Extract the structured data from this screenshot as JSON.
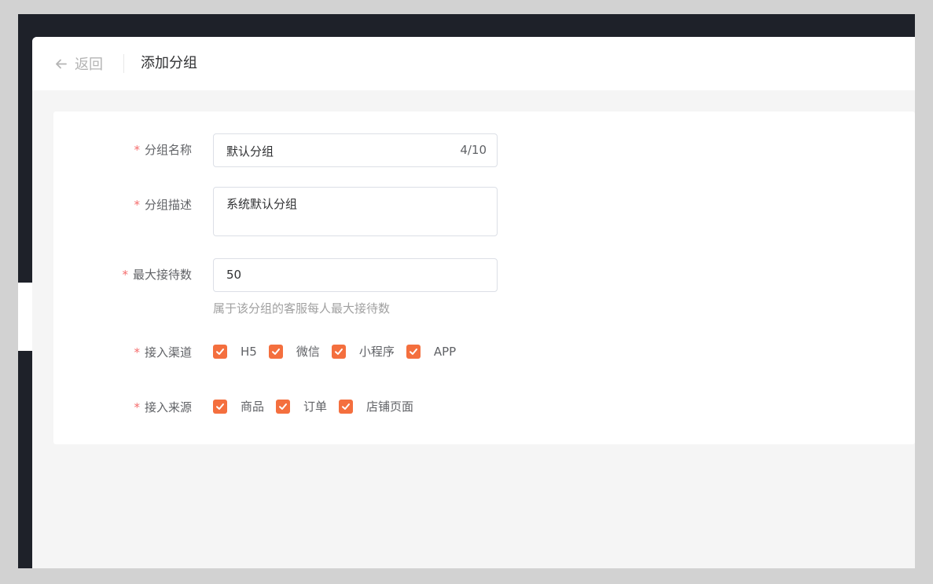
{
  "header": {
    "back_label": "返回",
    "title": "添加分组"
  },
  "form": {
    "name": {
      "label": "分组名称",
      "value": "默认分组",
      "count": "4/10"
    },
    "description": {
      "label": "分组描述",
      "value": "系统默认分组"
    },
    "max_reception": {
      "label": "最大接待数",
      "value": "50",
      "hint": "属于该分组的客服每人最大接待数"
    },
    "channels": {
      "label": "接入渠道",
      "options": [
        {
          "label": "H5",
          "checked": true
        },
        {
          "label": "微信",
          "checked": true
        },
        {
          "label": "小程序",
          "checked": true
        },
        {
          "label": "APP",
          "checked": true
        }
      ]
    },
    "sources": {
      "label": "接入来源",
      "options": [
        {
          "label": "商品",
          "checked": true
        },
        {
          "label": "订单",
          "checked": true
        },
        {
          "label": "店铺页面",
          "checked": true
        }
      ]
    },
    "required_mark": "*"
  },
  "colors": {
    "accent": "#f46f3e",
    "required": "#f56c6c",
    "sidebar": "#1e2129",
    "background": "#f5f5f5"
  }
}
